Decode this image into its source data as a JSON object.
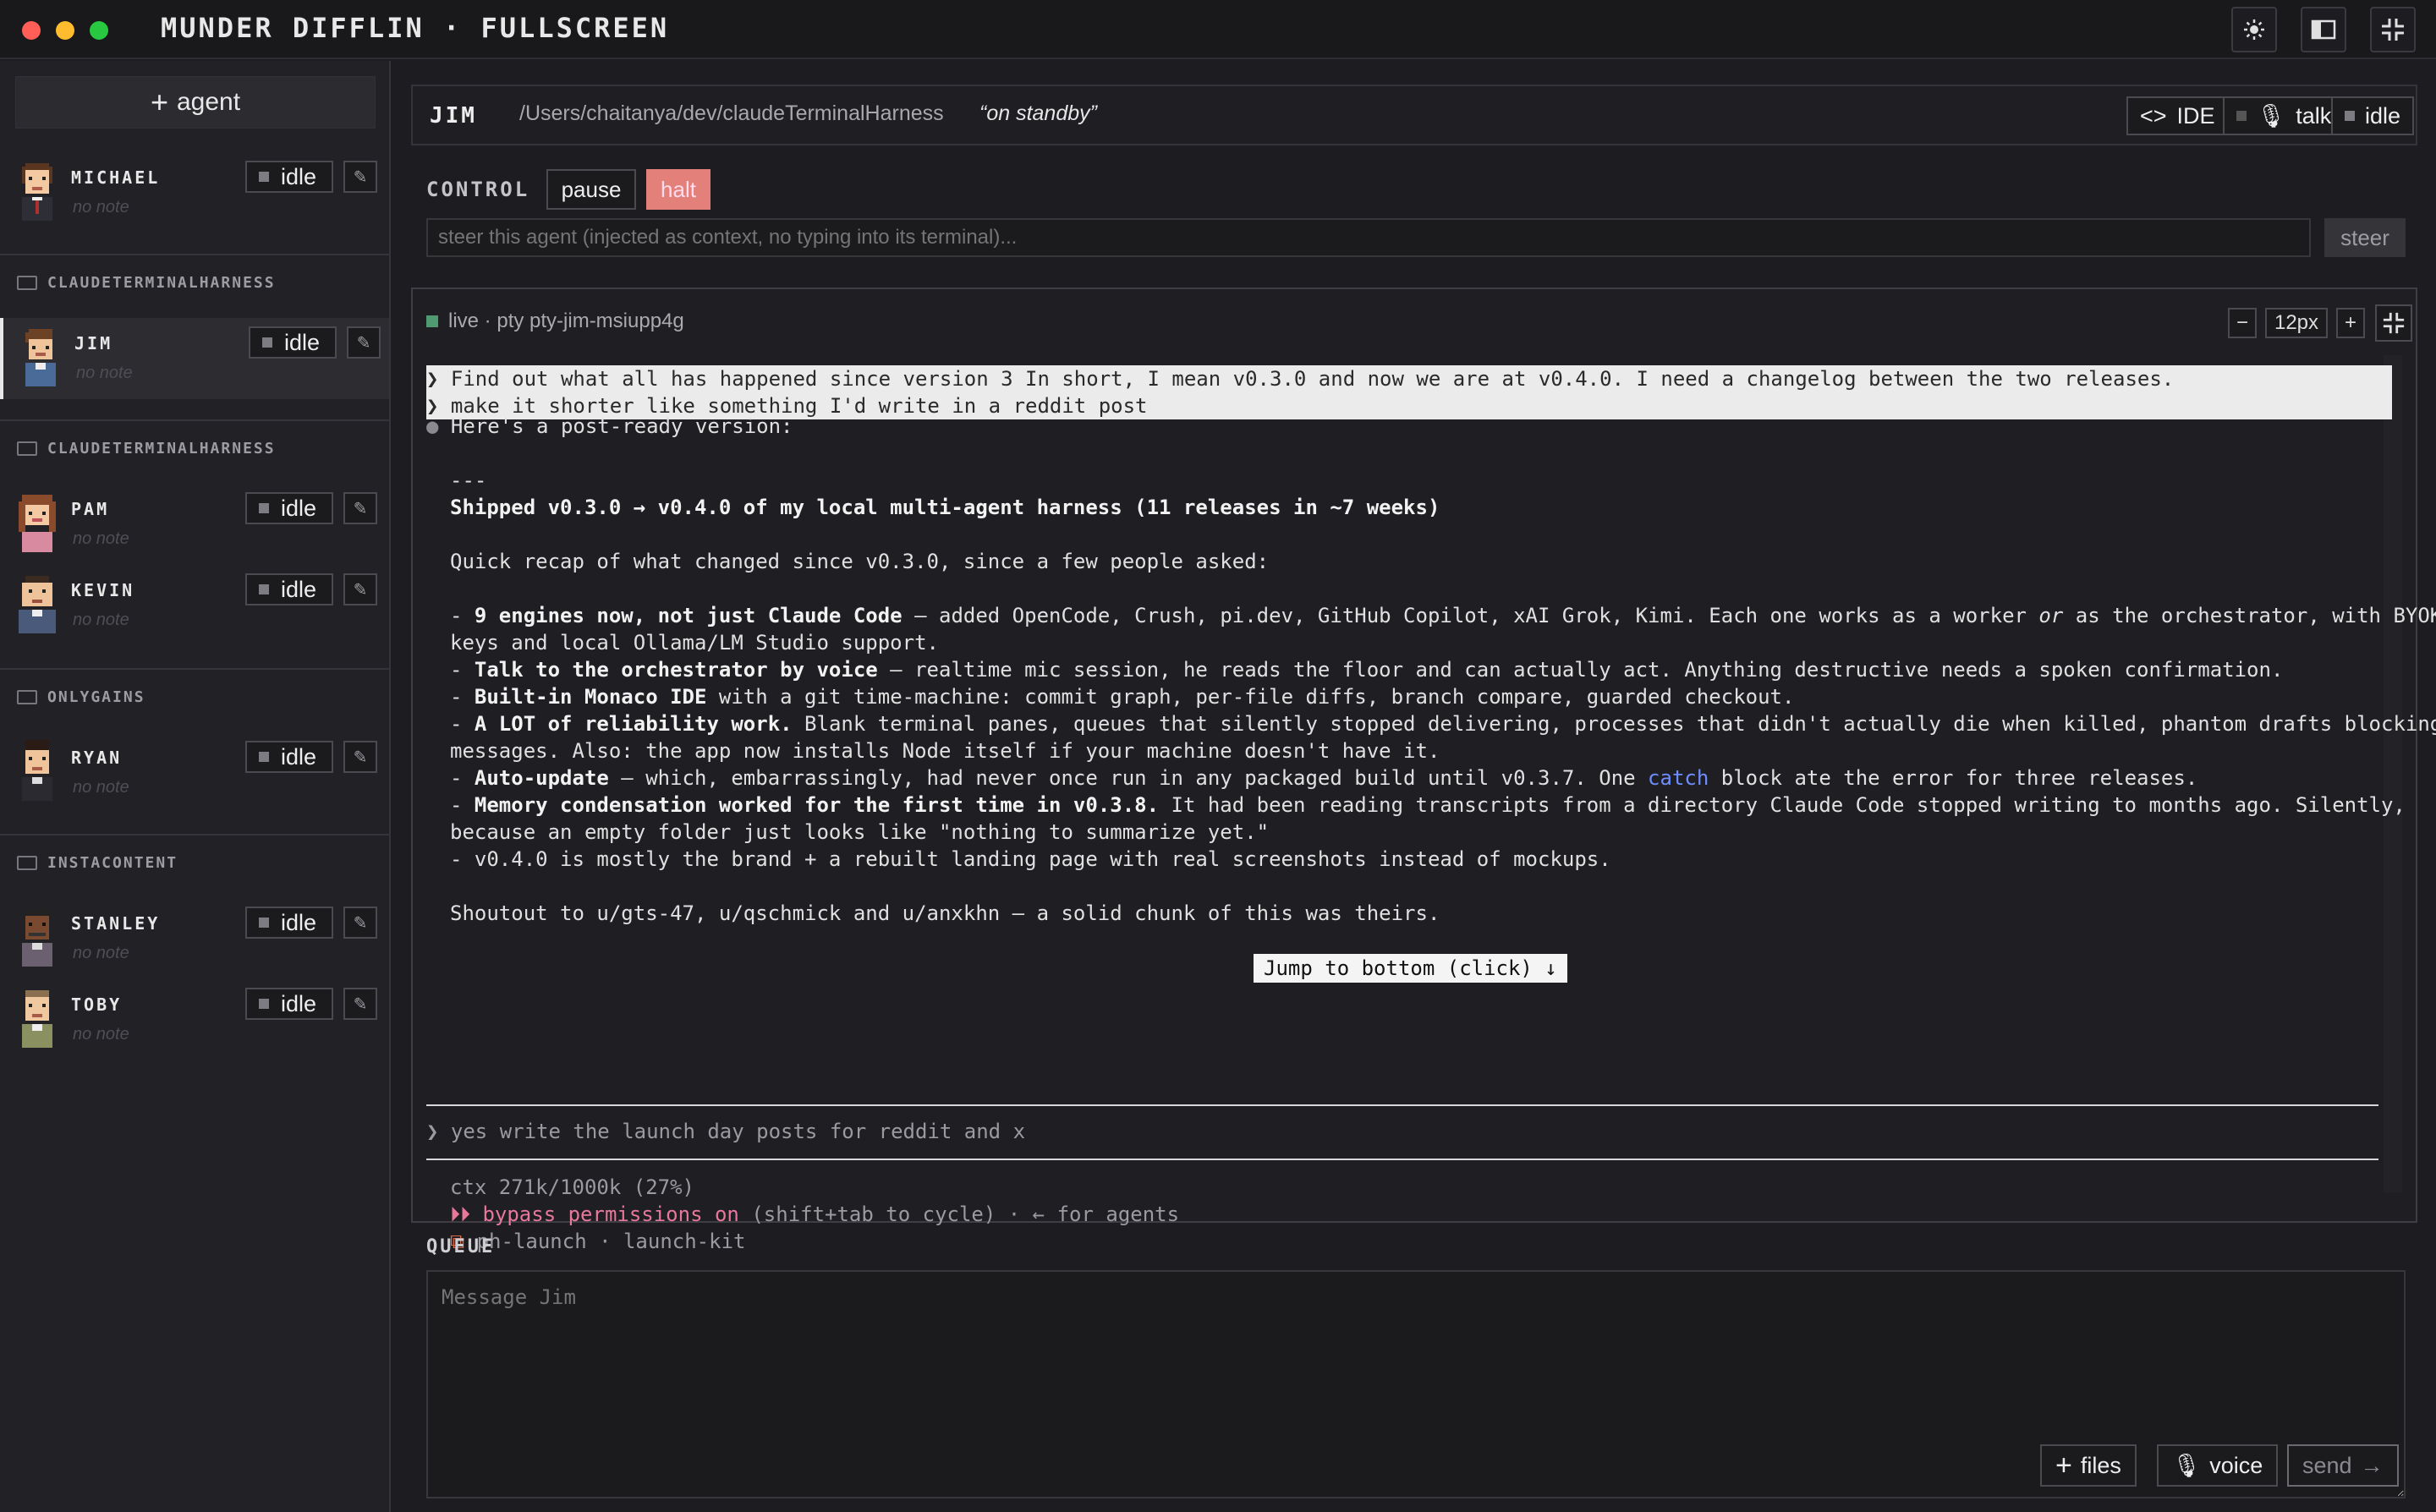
{
  "window": {
    "title": "MUNDER DIFFLIN · FULLSCREEN",
    "controls": {
      "theme": "sun-icon",
      "sidebar": "sidebar-toggle-icon",
      "fullscreen": "collapse-icon"
    }
  },
  "colors": {
    "close": "#ff5f57",
    "minimize": "#febc2e",
    "maximize": "#28c840",
    "halt": "#e38079",
    "live": "#4f9a71",
    "pink": "#e8779a",
    "link": "#6f8dff"
  },
  "sidebar": {
    "add_label": "agent",
    "groups": [
      {
        "name": "",
        "agents": [
          {
            "name": "MICHAEL",
            "status": "idle",
            "note": "no note"
          }
        ]
      },
      {
        "name": "CLAUDETERMINALHARNESS",
        "agents": [
          {
            "name": "JIM",
            "status": "idle",
            "note": "no note"
          }
        ]
      },
      {
        "name": "CLAUDETERMINALHARNESS",
        "agents": [
          {
            "name": "PAM",
            "status": "idle",
            "note": "no note"
          },
          {
            "name": "KEVIN",
            "status": "idle",
            "note": "no note"
          }
        ]
      },
      {
        "name": "ONLYGAINS",
        "agents": [
          {
            "name": "RYAN",
            "status": "idle",
            "note": "no note"
          }
        ]
      },
      {
        "name": "INSTACONTENT",
        "agents": [
          {
            "name": "STANLEY",
            "status": "idle",
            "note": "no note"
          },
          {
            "name": "TOBY",
            "status": "idle",
            "note": "no note"
          }
        ]
      }
    ]
  },
  "header": {
    "agent": "JIM",
    "path": "/Users/chaitanya/dev/claudeTerminalHarness",
    "status": "“on standby”",
    "ide_label": "IDE",
    "talk_label": "talk",
    "idle_label": "idle"
  },
  "control": {
    "label": "CONTROL",
    "pause": "pause",
    "halt": "halt",
    "steer_placeholder": "steer this agent (injected as context, no typing into its terminal)...",
    "steer_button": "steer"
  },
  "terminal": {
    "status": "live · pty pty-jim-msiupp4g",
    "font_size": "12px",
    "zoom_out": "−",
    "zoom_in": "+",
    "prompts": [
      "❯ Find out what all has happened since version 3 In short, I mean v0.3.0 and now we are at v0.4.0. I need a changelog between the two releases.",
      "❯ make it shorter like something I'd write in a reddit post"
    ],
    "intro": "Here's a post-ready version:",
    "rule": "---",
    "post_title": "Shipped v0.3.0 → v0.4.0 of my local multi-agent harness (11 releases in ~7 weeks)",
    "recap": "Quick recap of what changed since v0.3.0, since a few people asked:",
    "bullets": [
      {
        "bold": "9 engines now, not just Claude Code",
        "text": " — added OpenCode, Crush, pi.dev, GitHub Copilot, xAI Grok, Kimi. Each one works as a worker ",
        "em": "or",
        "text2": " as the orchestrator, with BYOK",
        "cont": "keys and local Ollama/LM Studio support."
      },
      {
        "bold": "Talk to the orchestrator by voice",
        "text": " — realtime mic session, he reads the floor and can actually act. Anything destructive needs a spoken confirmation."
      },
      {
        "bold": "Built-in Monaco IDE",
        "text": " with a git time-machine: commit graph, per-file diffs, branch compare, guarded checkout."
      },
      {
        "bold": "A LOT of reliability work.",
        "text": " Blank terminal panes, queues that silently stopped delivering, processes that didn't actually die when killed, phantom drafts blocking",
        "cont": "messages. Also: the app now installs Node itself if your machine doesn't have it."
      },
      {
        "bold": "Auto-update",
        "text": " — which, embarrassingly, had never once run in any packaged build until v0.3.7. One ",
        "link": "catch",
        "text2": " block ate the error for three releases."
      },
      {
        "bold": "Memory condensation worked for the first time in v0.3.8.",
        "text": " It had been reading transcripts from a directory Claude Code stopped writing to months ago. Silently,",
        "cont": "because an empty folder just looks like \"nothing to summarize yet.\""
      },
      {
        "bold": "",
        "text": "v0.4.0 is mostly the brand + a rebuilt landing page with real screenshots instead of mockups."
      }
    ],
    "shoutout": "Shoutout to u/gts-47, u/qschmick and u/anxkhn — a solid chunk of this was theirs.",
    "jump": "Jump to bottom (click) ↓",
    "input_line": "yes write the launch day posts for reddit and x",
    "ctx": "ctx 271k/1000k (27%)",
    "bypass_main": "⏵⏵ bypass permissions on",
    "bypass_rest": " (shift+tab to cycle) · ← for agents",
    "branch": "ph-launch · launch-kit"
  },
  "queue": {
    "label": "QUEUE",
    "placeholder": "Message Jim",
    "files": "files",
    "voice": "voice",
    "send": "send"
  }
}
